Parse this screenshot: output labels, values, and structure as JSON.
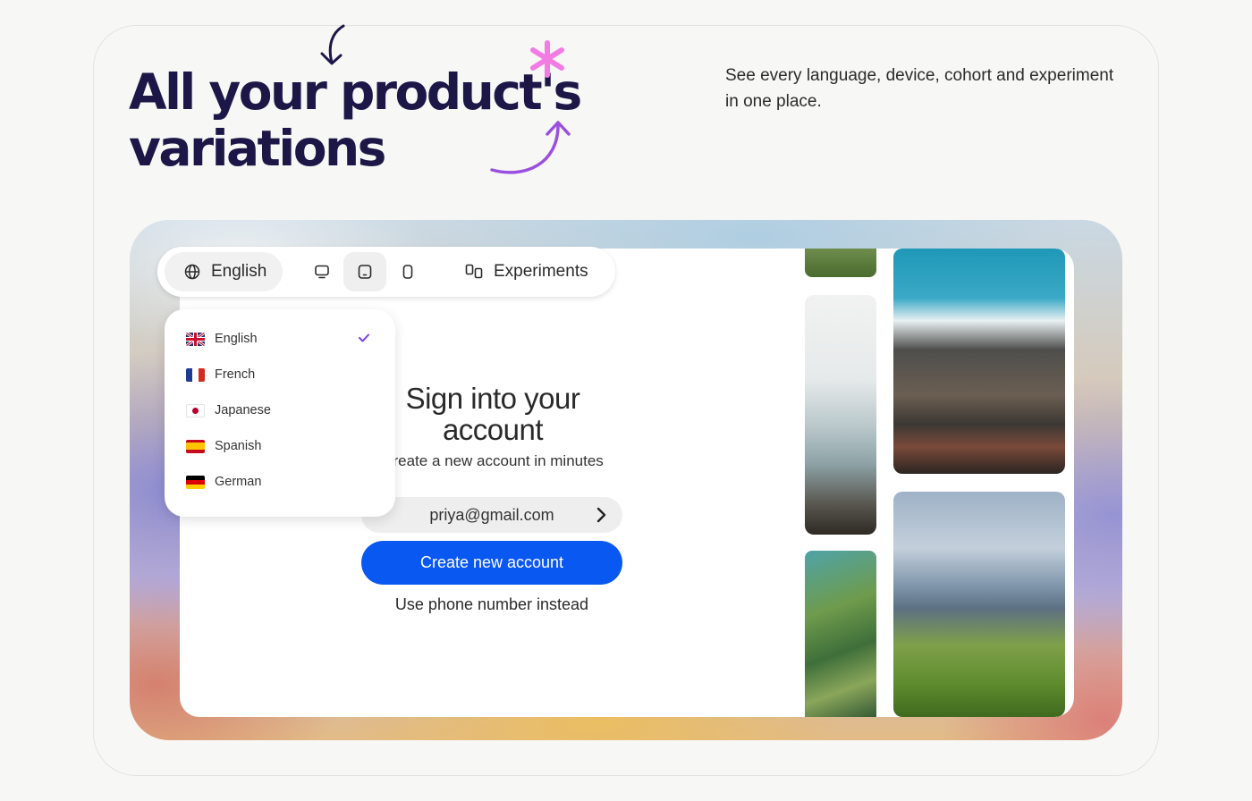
{
  "headline": {
    "line1": "All your product's",
    "line2": "variations"
  },
  "subtext": "See every language, device, cohort and experiment in one place.",
  "toolbar": {
    "language_label": "English",
    "experiments_label": "Experiments",
    "devices": [
      "desktop",
      "tablet",
      "mobile"
    ],
    "active_device": "tablet"
  },
  "language_menu": {
    "selected": "English",
    "items": [
      {
        "label": "English",
        "flag": "uk-flag-icon"
      },
      {
        "label": "French",
        "flag": "france-flag-icon"
      },
      {
        "label": "Japanese",
        "flag": "japan-flag-icon"
      },
      {
        "label": "Spanish",
        "flag": "spain-flag-icon"
      },
      {
        "label": "German",
        "flag": "germany-flag-icon"
      }
    ]
  },
  "signin": {
    "title": "Sign into your account",
    "subtitle": "Create a new account in minutes",
    "email": "priya@gmail.com",
    "cta": "Create new account",
    "alt_link": "Use phone number instead"
  },
  "colors": {
    "headline": "#1c1747",
    "accent_pink": "#f27ce3",
    "accent_purple": "#9b4fe0",
    "cta_blue": "#0a58f2",
    "check_purple": "#7b3fe4"
  }
}
